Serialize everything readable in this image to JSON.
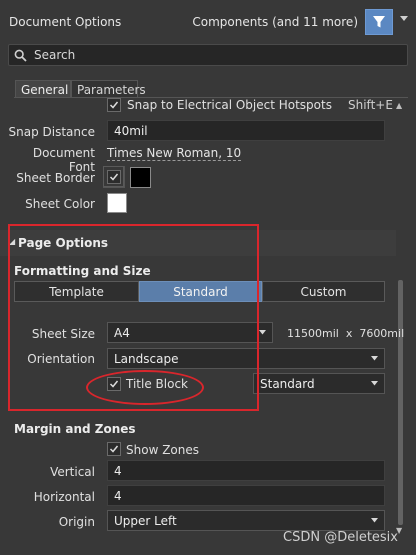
{
  "header": {
    "title": "Document Options",
    "filter_text": "Components (and 11 more)"
  },
  "search": {
    "placeholder": "Search"
  },
  "tabs": [
    {
      "label": "General"
    },
    {
      "label": "Parameters"
    }
  ],
  "general": {
    "snap_hotspots": {
      "label": "Snap to Electrical Object Hotspots",
      "shortcut": "Shift+E",
      "checked": true
    },
    "snap_distance": {
      "label": "Snap Distance",
      "value": "40mil"
    },
    "document_font": {
      "label": "Document Font",
      "value": "Times New Roman, 10"
    },
    "sheet_border": {
      "label": "Sheet Border",
      "checked": true,
      "color": "#000000"
    },
    "sheet_color": {
      "label": "Sheet Color",
      "color": "#ffffff"
    }
  },
  "page_options": {
    "title": "Page Options",
    "formatting": {
      "title": "Formatting and Size",
      "modes": [
        "Template",
        "Standard",
        "Custom"
      ],
      "active_mode": "Standard",
      "sheet_size": {
        "label": "Sheet Size",
        "value": "A4",
        "dimensions": "11500mil  x  7600mil"
      },
      "orientation": {
        "label": "Orientation",
        "value": "Landscape"
      },
      "title_block": {
        "label": "Title Block",
        "checked": true,
        "style": "Standard"
      }
    },
    "margin": {
      "title": "Margin and Zones",
      "show_zones": {
        "label": "Show Zones",
        "checked": true
      },
      "vertical": {
        "label": "Vertical",
        "value": "4"
      },
      "horizontal": {
        "label": "Horizontal",
        "value": "4"
      },
      "origin": {
        "label": "Origin",
        "value": "Upper Left"
      }
    }
  },
  "watermark": "CSDN @Deletesix",
  "colors": {
    "accent": "#5b88c2",
    "annotation": "#d9262c"
  }
}
